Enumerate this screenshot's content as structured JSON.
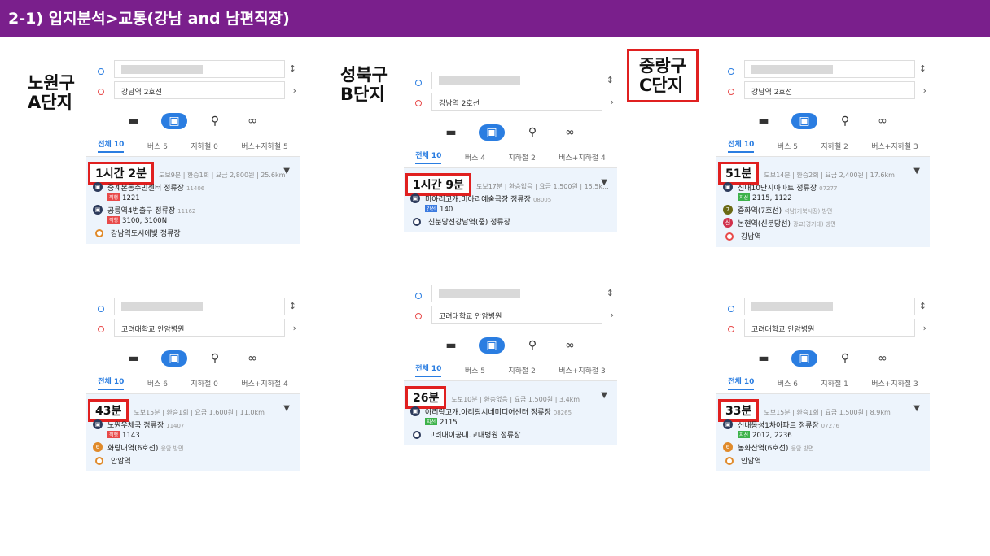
{
  "title": "2-1) 입지분석>교통(강남 and 남편직장)",
  "labels": {
    "a": "노원구\nA단지",
    "b": "성북구\nB단지",
    "c": "중랑구\nC단지"
  },
  "colors": {
    "header": "#7a1f8c",
    "accent": "#2a7de1",
    "highlight": "#e02020"
  },
  "mode_icons": [
    "car-icon",
    "bus-icon",
    "walk-icon",
    "bike-icon"
  ],
  "panels": {
    "a1": {
      "from": "",
      "to": "강남역 2호선",
      "tabs": [
        "전체 10",
        "버스 5",
        "지하철 0",
        "버스+지하철 5"
      ],
      "time": "1시간 2분",
      "meta": "도보9분 | 환승1회 | 요금 2,800원 | 25.6km",
      "steps": [
        {
          "name": "중계본동주민센터 정류장",
          "id": "11406",
          "badge": "직행",
          "lines": "1221"
        },
        {
          "name": "공릉역4번출구 정류장",
          "id": "11162",
          "badge": "직행",
          "lines": "3100, 3100N"
        },
        {
          "name": "강남역도시에빛 정류장"
        }
      ]
    },
    "a2": {
      "from": "",
      "to": "고려대학교 안암병원",
      "tabs": [
        "전체 10",
        "버스 6",
        "지하철 0",
        "버스+지하철 4"
      ],
      "time": "43분",
      "meta": "도보15분 | 환승1회 | 요금 1,600원 | 11.0km",
      "steps": [
        {
          "name": "노원우체국 정류장",
          "id": "11407",
          "badge": "직행",
          "lines": "1143"
        },
        {
          "name": "화랑대역(6호선)",
          "note": "응암 방면"
        },
        {
          "name": "안암역"
        }
      ]
    },
    "b1": {
      "from": "",
      "to": "강남역 2호선",
      "tabs": [
        "전체 10",
        "버스 4",
        "지하철 2",
        "버스+지하철 4"
      ],
      "time": "1시간 9분",
      "meta": "도보17분 | 환승없음 | 요금 1,500원 | 15.5k...",
      "steps": [
        {
          "name": "미아리고개.미아리예술극장 정류장",
          "id": "08005",
          "badge": "간선",
          "lines": "140"
        },
        {
          "name": "신분당선강남역(중) 정류장"
        }
      ]
    },
    "b2": {
      "from": "",
      "to": "고려대학교 안암병원",
      "tabs": [
        "전체 10",
        "버스 5",
        "지하철 2",
        "버스+지하철 3"
      ],
      "time": "26분",
      "meta": "도보10분 | 환승없음 | 요금 1,500원 | 3.4km",
      "steps": [
        {
          "name": "아리랑고개.아리랑시네미디어센터 정류장",
          "id": "08265",
          "badge": "지선",
          "lines": "2115"
        },
        {
          "name": "고려대이공대.고대병원 정류장"
        }
      ]
    },
    "c1": {
      "from": "",
      "to": "강남역 2호선",
      "tabs": [
        "전체 10",
        "버스 5",
        "지하철 2",
        "버스+지하철 3"
      ],
      "time": "51분",
      "meta": "도보14분 | 환승2회 | 요금 2,400원 | 17.6km",
      "steps": [
        {
          "name": "신내10단지아파트 정류장",
          "id": "07277",
          "badge": "지선",
          "lines": "2115, 1122"
        },
        {
          "name": "중화역(7호선)",
          "note": "석남(거북시장) 방면"
        },
        {
          "name": "논현역(신분당선)",
          "note": "광교(경기대) 방면"
        },
        {
          "name": "강남역"
        }
      ]
    },
    "c2": {
      "from": "",
      "to": "고려대학교 안암병원",
      "tabs": [
        "전체 10",
        "버스 6",
        "지하철 1",
        "버스+지하철 3"
      ],
      "time": "33분",
      "meta": "도보15분 | 환승1회 | 요금 1,500원 | 8.9km",
      "steps": [
        {
          "name": "신내동성1차아파트 정류장",
          "id": "07276",
          "badge": "지선",
          "lines": "2012, 2236"
        },
        {
          "name": "봉화산역(6호선)",
          "note": "응암 방면"
        },
        {
          "name": "안암역"
        }
      ]
    }
  }
}
